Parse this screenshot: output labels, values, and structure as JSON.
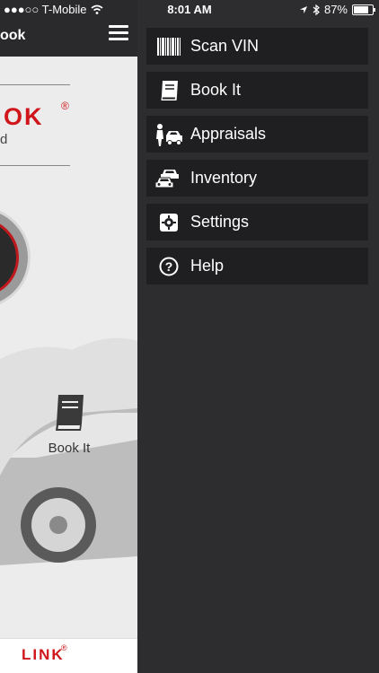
{
  "status_bar": {
    "carrier": "●●●○○ T-Mobile",
    "time": "8:01 AM",
    "battery": "87%",
    "battery_level": 0.87
  },
  "left_panel": {
    "header_title": "ook",
    "logo_text": "OK",
    "logo_reg": "®",
    "logo_sub": "d",
    "tile_label": "Book It",
    "footer_text": "LINK",
    "footer_reg": "®"
  },
  "menu": {
    "items": [
      {
        "label": "Scan VIN",
        "icon": "barcode-icon"
      },
      {
        "label": "Book It",
        "icon": "book-icon"
      },
      {
        "label": "Appraisals",
        "icon": "appraisal-icon"
      },
      {
        "label": "Inventory",
        "icon": "cars-icon"
      },
      {
        "label": "Settings",
        "icon": "gear-icon"
      },
      {
        "label": "Help",
        "icon": "help-icon"
      }
    ]
  },
  "colors": {
    "drawer_bg": "#2d2d30",
    "item_bg": "#1f1f21",
    "brand_red": "#d0161b"
  }
}
